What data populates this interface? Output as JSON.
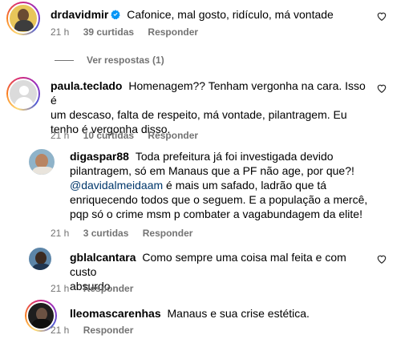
{
  "comments": [
    {
      "username": "drdavidmir",
      "verified": true,
      "text": "Cafonice, mal gosto, ridículo, má vontade",
      "time": "21 h",
      "likes": "39 curtidas",
      "reply": "Responder",
      "view_replies": "Ver respostas (1)"
    },
    {
      "username": "paula.teclado",
      "text_lines": [
        "Homenagem?? Tenham vergonha na cara. Isso é",
        "um descaso, falta de respeito, má vontade, pilantragem. Eu",
        "tenho é vergonha disso."
      ],
      "time": "21 h",
      "likes": "10 curtidas",
      "reply": "Responder"
    },
    {
      "username": "digaspar88",
      "text_first": "Toda prefeitura já foi investigada devido",
      "text_lines": [
        "pilantragem, só em Manaus que a PF não age, por que?!"
      ],
      "mention": "@davidalmeidaam",
      "mention_rest": " é mais um safado, ladrão que tá",
      "text_lines_after": [
        "enriquecendo todos que o seguem. E a população a mercê,",
        "pqp só o crime msm p combater a vagabundagem da elite!"
      ],
      "time": "21 h",
      "likes": "3 curtidas",
      "reply": "Responder"
    },
    {
      "username": "gblalcantara",
      "text_first": "Como sempre uma coisa mal feita e com custo",
      "text_line2": "absurdo",
      "time": "21 h",
      "reply": "Responder"
    },
    {
      "username": "lleomascarenhas",
      "text": "Manaus e sua crise estética.",
      "time": "21 h",
      "reply": "Responder"
    }
  ],
  "colors": {
    "meta": "#737373",
    "link": "#00376b",
    "verified": "#0095f6"
  },
  "icons": [
    "heart-icon",
    "verified-badge-icon"
  ]
}
